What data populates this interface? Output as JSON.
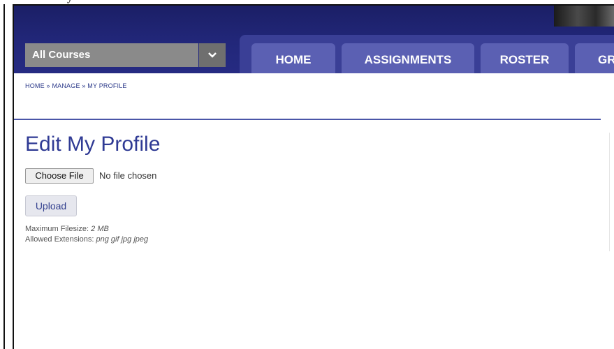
{
  "top_strip": {
    "text": "y"
  },
  "course_selector": {
    "value": "All Courses"
  },
  "nav": {
    "tabs": [
      {
        "label": "HOME"
      },
      {
        "label": "ASSIGNMENTS"
      },
      {
        "label": "ROSTER"
      },
      {
        "label": "GR"
      }
    ]
  },
  "breadcrumb": {
    "items": [
      "HOME",
      "MANAGE",
      "MY PROFILE"
    ],
    "separator": "»"
  },
  "main": {
    "title": "Edit My Profile",
    "file_input": {
      "button_label": "Choose File",
      "status": "No file chosen"
    },
    "upload_label": "Upload",
    "max_filesize_label": "Maximum Filesize:",
    "max_filesize_value": "2 MB",
    "extensions_label": "Allowed Extensions:",
    "extensions_value": "png gif jpg jpeg"
  },
  "colors": {
    "header_bg": "#22277a",
    "tab_bg": "#5b60b3",
    "accent_text": "#2f3a94"
  }
}
